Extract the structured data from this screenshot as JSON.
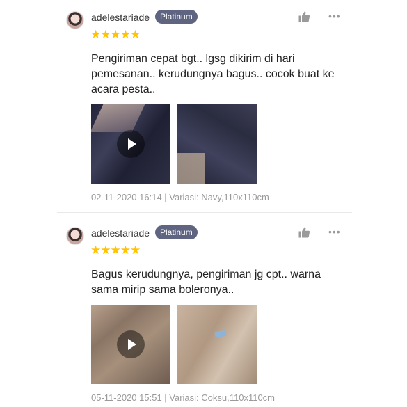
{
  "reviews": [
    {
      "username": "adelestariade",
      "badge": "Platinum",
      "stars": "★★★★★",
      "comment": "Pengiriman cepat bgt.. lgsg dikirim di hari pemesanan.. kerudungnya bagus.. cocok buat ke acara pesta..",
      "meta": "02-11-2020 16:14 | Variasi: Navy,110x110cm",
      "media": [
        {
          "type": "video",
          "tone": "navy"
        },
        {
          "type": "image",
          "tone": "navy"
        }
      ]
    },
    {
      "username": "adelestariade",
      "badge": "Platinum",
      "stars": "★★★★★",
      "comment": "Bagus kerudungnya, pengiriman jg cpt.. warna sama mirip sama boleronya..",
      "meta": "05-11-2020 15:51 | Variasi: Coksu,110x110cm",
      "media": [
        {
          "type": "video",
          "tone": "brown"
        },
        {
          "type": "image",
          "tone": "brown"
        }
      ]
    }
  ],
  "icons": {
    "like": "thumbs-up-icon",
    "more": "more-options-icon",
    "play": "play-icon"
  },
  "colors": {
    "badge_bg": "#5f6480",
    "star": "#ffc300",
    "meta_text": "#9a9a9a",
    "more_dots": "•••"
  }
}
